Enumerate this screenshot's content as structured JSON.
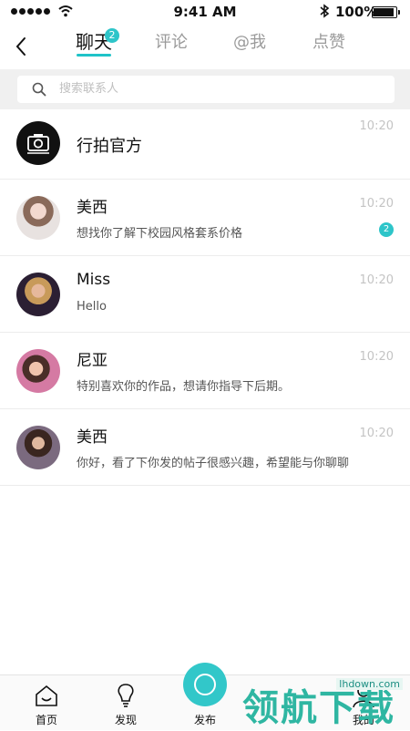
{
  "status_bar": {
    "time": "9:41 AM",
    "battery": "100%"
  },
  "tabs": [
    {
      "label": "聊天",
      "badge": "2",
      "active": true
    },
    {
      "label": "评论"
    },
    {
      "label": "@我"
    },
    {
      "label": "点赞"
    }
  ],
  "search": {
    "placeholder": "搜索联系人"
  },
  "chats": [
    {
      "name": "行拍官方",
      "message": "",
      "time": "10:20",
      "badge": ""
    },
    {
      "name": "美西",
      "message": "想找你了解下校园风格套系价格",
      "time": "10:20",
      "badge": "2"
    },
    {
      "name": "Miss",
      "message": "Hello",
      "time": "10:20",
      "badge": ""
    },
    {
      "name": "尼亚",
      "message": "特别喜欢你的作品，想请你指导下后期。",
      "time": "10:20",
      "badge": ""
    },
    {
      "name": "美西",
      "message": "你好，看了下你发的帖子很感兴趣，希望能与你聊聊",
      "time": "10:20",
      "badge": ""
    }
  ],
  "bottom_nav": [
    {
      "label": "首页",
      "icon": "home-icon"
    },
    {
      "label": "发现",
      "icon": "lightbulb-icon"
    },
    {
      "label": "发布",
      "icon": "publish-icon"
    },
    {
      "label": "我的",
      "icon": "profile-icon"
    }
  ],
  "watermark": {
    "text": "领航下载",
    "url": "lhdown.com"
  },
  "colors": {
    "accent": "#2ec5c9",
    "watermark": "#2fb6a2"
  }
}
